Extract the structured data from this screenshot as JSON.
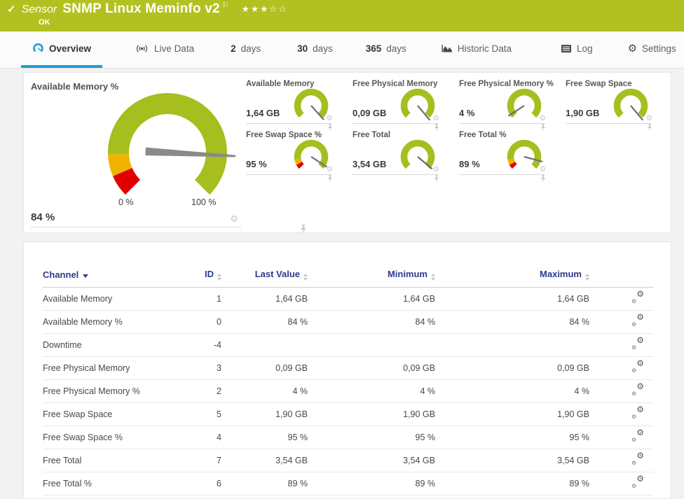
{
  "header": {
    "section_label": "Sensor",
    "title": "SNMP Linux Meminfo v2",
    "status": "OK",
    "stars": "★★★☆☆"
  },
  "icons": {
    "check": "✓",
    "flag": "⚐",
    "gear": "⚙"
  },
  "tabs": {
    "overview": {
      "label": "Overview"
    },
    "live_data": {
      "label": "Live Data"
    },
    "days_2": {
      "num": "2",
      "unit": "days"
    },
    "days_30": {
      "num": "30",
      "unit": "days"
    },
    "days_365": {
      "num": "365",
      "unit": "days"
    },
    "historic_data": {
      "label": "Historic Data"
    },
    "log": {
      "label": "Log"
    },
    "settings": {
      "label": "Settings"
    }
  },
  "gauges": {
    "main": {
      "title": "Available Memory %",
      "value": "84 %",
      "scale_min": "0 %",
      "scale_max": "100 %",
      "needle_deg": -3,
      "segments": [
        {
          "from": 0,
          "to": 0.08,
          "color": "#e00000"
        },
        {
          "from": 0.08,
          "to": 0.16,
          "color": "#f0b400"
        },
        {
          "from": 0.16,
          "to": 1,
          "color": "#a6be1e"
        }
      ]
    },
    "small": [
      {
        "title": "Available Memory",
        "value": "1,64 GB",
        "needle_deg": -48,
        "segments": [
          {
            "from": 0,
            "to": 1,
            "color": "#a6be1e"
          }
        ]
      },
      {
        "title": "Free Physical Memory",
        "value": "0,09 GB",
        "needle_deg": -50,
        "segments": [
          {
            "from": 0,
            "to": 1,
            "color": "#a6be1e"
          }
        ]
      },
      {
        "title": "Free Physical Memory %",
        "value": "4 %",
        "needle_deg": 213,
        "segments": [
          {
            "from": 0,
            "to": 1,
            "color": "#a6be1e"
          }
        ]
      },
      {
        "title": "Free Swap Space",
        "value": "1,90 GB",
        "needle_deg": -50,
        "segments": [
          {
            "from": 0,
            "to": 1,
            "color": "#a6be1e"
          }
        ]
      },
      {
        "title": "Free Swap Space %",
        "value": "95 %",
        "needle_deg": -33,
        "segments": [
          {
            "from": 0,
            "to": 0.06,
            "color": "#e00000"
          },
          {
            "from": 0.06,
            "to": 0.13,
            "color": "#f0b400"
          },
          {
            "from": 0.13,
            "to": 1,
            "color": "#a6be1e"
          }
        ]
      },
      {
        "title": "Free Total",
        "value": "3,54 GB",
        "needle_deg": -40,
        "segments": [
          {
            "from": 0,
            "to": 1,
            "color": "#a6be1e"
          }
        ]
      },
      {
        "title": "Free Total %",
        "value": "89 %",
        "needle_deg": -15,
        "segments": [
          {
            "from": 0,
            "to": 0.06,
            "color": "#e00000"
          },
          {
            "from": 0.06,
            "to": 0.13,
            "color": "#f0b400"
          },
          {
            "from": 0.13,
            "to": 1,
            "color": "#a6be1e"
          }
        ]
      }
    ]
  },
  "table": {
    "columns": [
      "Channel",
      "ID",
      "Last Value",
      "Minimum",
      "Maximum"
    ],
    "rows": [
      {
        "channel": "Available Memory",
        "id": "1",
        "last": "1,64 GB",
        "min": "1,64 GB",
        "max": "1,64 GB"
      },
      {
        "channel": "Available Memory %",
        "id": "0",
        "last": "84 %",
        "min": "84 %",
        "max": "84 %"
      },
      {
        "channel": "Downtime",
        "id": "-4",
        "last": "",
        "min": "",
        "max": ""
      },
      {
        "channel": "Free Physical Memory",
        "id": "3",
        "last": "0,09 GB",
        "min": "0,09 GB",
        "max": "0,09 GB"
      },
      {
        "channel": "Free Physical Memory %",
        "id": "2",
        "last": "4 %",
        "min": "4 %",
        "max": "4 %"
      },
      {
        "channel": "Free Swap Space",
        "id": "5",
        "last": "1,90 GB",
        "min": "1,90 GB",
        "max": "1,90 GB"
      },
      {
        "channel": "Free Swap Space %",
        "id": "4",
        "last": "95 %",
        "min": "95 %",
        "max": "95 %"
      },
      {
        "channel": "Free Total",
        "id": "7",
        "last": "3,54 GB",
        "min": "3,54 GB",
        "max": "3,54 GB"
      },
      {
        "channel": "Free Total %",
        "id": "6",
        "last": "89 %",
        "min": "89 %",
        "max": "89 %"
      }
    ]
  },
  "colors": {
    "header_bg": "#b3c120",
    "accent_blue": "#1d9cd9",
    "table_header_text": "#2a3b8f",
    "gauge_green": "#a6be1e",
    "gauge_yellow": "#f0b400",
    "gauge_red": "#e00000"
  }
}
